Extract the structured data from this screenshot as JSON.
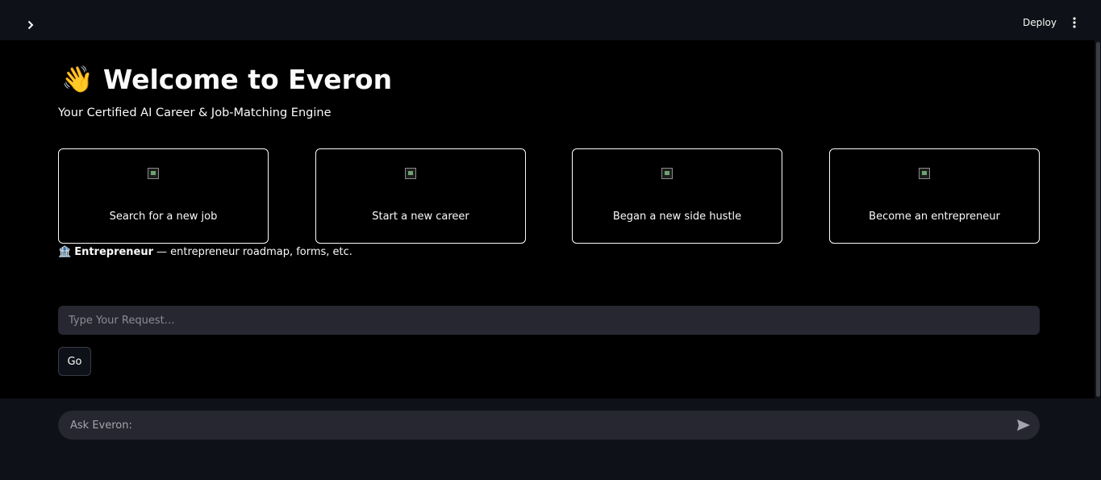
{
  "header": {
    "deploy_label": "Deploy",
    "sidebar_toggle_icon": "chevron-right-icon",
    "menu_icon": "kebab-menu-icon"
  },
  "main": {
    "title_emoji": "👋",
    "title": "Welcome to Everon",
    "subtitle": "Your Certified AI Career & Job-Matching Engine",
    "cards": [
      {
        "label": "Search for a new job",
        "icon": "broken-image-icon"
      },
      {
        "label": "Start a new career",
        "icon": "broken-image-icon"
      },
      {
        "label": "Began a new side hustle",
        "icon": "broken-image-icon"
      },
      {
        "label": "Become an entrepreneur",
        "icon": "broken-image-icon"
      }
    ],
    "info": {
      "emoji": "🏦",
      "bold": "Entrepreneur",
      "text": "— entrepreneur roadmap, forms, etc."
    },
    "request_placeholder": "Type Your Request…",
    "go_label": "Go"
  },
  "chat": {
    "placeholder": "Ask Everon:",
    "send_icon": "send-icon"
  },
  "colors": {
    "background": "#000000",
    "header_bg": "#0e1117",
    "input_bg": "#262730",
    "text": "#fafafa"
  }
}
